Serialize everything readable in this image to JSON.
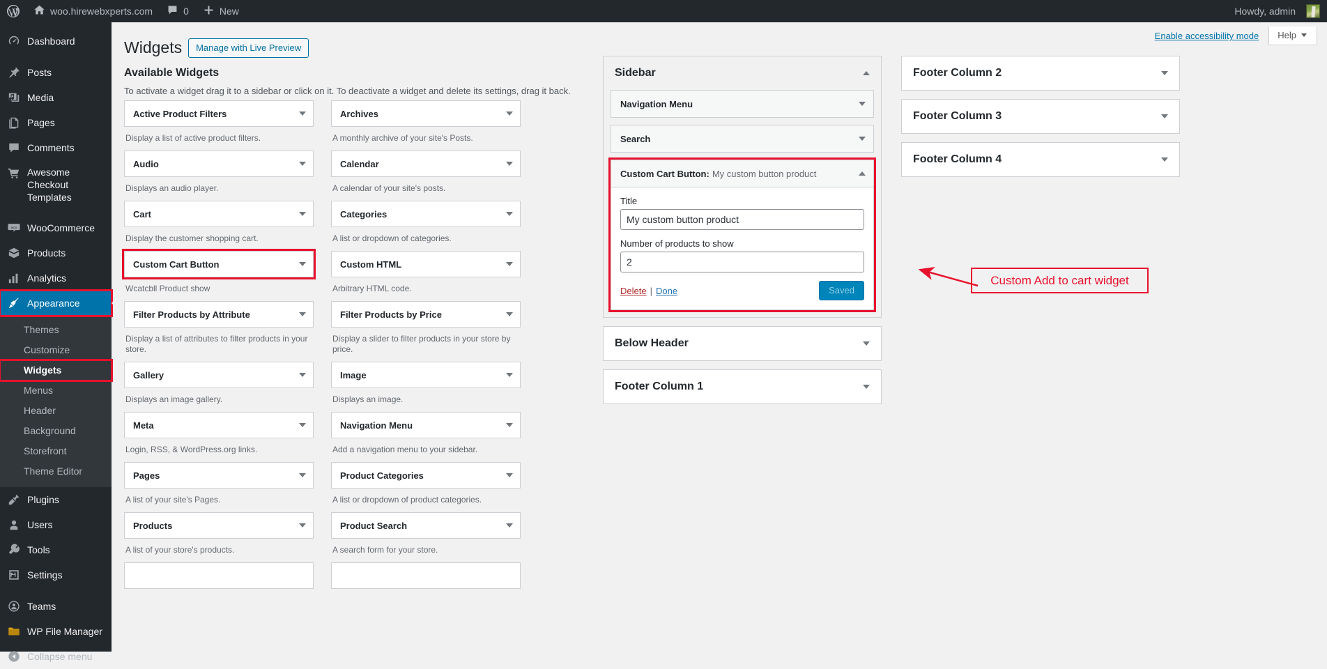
{
  "adminbar": {
    "logo_icon": "wordpress-logo-icon",
    "site_icon": "home-icon",
    "site_name": "woo.hirewebxperts.com",
    "comments_icon": "comment-bubble-icon",
    "comments_count": "0",
    "new_icon": "plus-icon",
    "new_label": "New",
    "howdy": "Howdy, admin",
    "avatar": "user-avatar"
  },
  "adminmenu": {
    "items": [
      {
        "label": "Dashboard",
        "icon": "dashboard-icon",
        "current": false
      },
      {
        "label": "Posts",
        "icon": "pin-icon",
        "current": false
      },
      {
        "label": "Media",
        "icon": "media-icon",
        "current": false
      },
      {
        "label": "Pages",
        "icon": "pages-icon",
        "current": false
      },
      {
        "label": "Comments",
        "icon": "comment-bubble-icon",
        "current": false
      },
      {
        "label": "Awesome Checkout Templates",
        "icon": "cart-icon",
        "current": false
      },
      {
        "label": "WooCommerce",
        "icon": "woo-icon",
        "current": false
      },
      {
        "label": "Products",
        "icon": "products-box-icon",
        "current": false
      },
      {
        "label": "Analytics",
        "icon": "bar-chart-icon",
        "current": false
      },
      {
        "label": "Appearance",
        "icon": "paintbrush-icon",
        "current": true
      },
      {
        "label": "Plugins",
        "icon": "plug-icon",
        "current": false
      },
      {
        "label": "Users",
        "icon": "user-icon",
        "current": false
      },
      {
        "label": "Tools",
        "icon": "wrench-icon",
        "current": false
      },
      {
        "label": "Settings",
        "icon": "settings-sliders-icon",
        "current": false
      },
      {
        "label": "Teams",
        "icon": "teams-icon",
        "current": false
      },
      {
        "label": "WP File Manager",
        "icon": "folder-icon",
        "current": false
      }
    ],
    "submenu": [
      {
        "label": "Themes",
        "current": false
      },
      {
        "label": "Customize",
        "current": false
      },
      {
        "label": "Widgets",
        "current": true
      },
      {
        "label": "Menus",
        "current": false
      },
      {
        "label": "Header",
        "current": false
      },
      {
        "label": "Background",
        "current": false
      },
      {
        "label": "Storefront",
        "current": false
      },
      {
        "label": "Theme Editor",
        "current": false
      }
    ],
    "collapse": {
      "label": "Collapse menu",
      "icon": "collapse-arrow-icon"
    }
  },
  "topbar": {
    "accessibility_link": "Enable accessibility mode",
    "help_label": "Help",
    "help_caret_icon": "chevron-down-icon"
  },
  "page": {
    "title": "Widgets",
    "live_preview_button": "Manage with Live Preview",
    "available_title": "Available Widgets",
    "available_desc": "To activate a widget drag it to a sidebar or click on it. To deactivate a widget and delete its settings, drag it back."
  },
  "available_widgets": [
    {
      "name": "Active Product Filters",
      "desc": "Display a list of active product filters.",
      "flagged": false
    },
    {
      "name": "Archives",
      "desc": "A monthly archive of your site's Posts.",
      "flagged": false
    },
    {
      "name": "Audio",
      "desc": "Displays an audio player.",
      "flagged": false
    },
    {
      "name": "Calendar",
      "desc": "A calendar of your site's posts.",
      "flagged": false
    },
    {
      "name": "Cart",
      "desc": "Display the customer shopping cart.",
      "flagged": false
    },
    {
      "name": "Categories",
      "desc": "A list or dropdown of categories.",
      "flagged": false
    },
    {
      "name": "Custom Cart Button",
      "desc": "Wcatcbll Product show",
      "flagged": true
    },
    {
      "name": "Custom HTML",
      "desc": "Arbitrary HTML code.",
      "flagged": false
    },
    {
      "name": "Filter Products by Attribute",
      "desc": "Display a list of attributes to filter products in your store.",
      "flagged": false
    },
    {
      "name": "Filter Products by Price",
      "desc": "Display a slider to filter products in your store by price.",
      "flagged": false
    },
    {
      "name": "Gallery",
      "desc": "Displays an image gallery.",
      "flagged": false
    },
    {
      "name": "Image",
      "desc": "Displays an image.",
      "flagged": false
    },
    {
      "name": "Meta",
      "desc": "Login, RSS, & WordPress.org links.",
      "flagged": false
    },
    {
      "name": "Navigation Menu",
      "desc": "Add a navigation menu to your sidebar.",
      "flagged": false
    },
    {
      "name": "Pages",
      "desc": "A list of your site's Pages.",
      "flagged": false
    },
    {
      "name": "Product Categories",
      "desc": "A list or dropdown of product categories.",
      "flagged": false
    },
    {
      "name": "Products",
      "desc": "A list of your store's products.",
      "flagged": false
    },
    {
      "name": "Product Search",
      "desc": "A search form for your store.",
      "flagged": false
    }
  ],
  "sidebar_panel": {
    "title": "Sidebar",
    "caret_icon": "chevron-up-icon",
    "widgets": [
      {
        "title": "Navigation Menu",
        "caret_icon": "chevron-down-icon",
        "open": false
      },
      {
        "title": "Search",
        "caret_icon": "chevron-down-icon",
        "open": false
      }
    ],
    "active_widget": {
      "title": "Custom Cart Button:",
      "subtitle": "My custom button product",
      "caret_icon": "chevron-up-icon",
      "title_field_label": "Title",
      "title_field_value": "My custom button product",
      "count_field_label": "Number of products to show",
      "count_field_value": "2",
      "delete_label": "Delete",
      "separator": "|",
      "done_label": "Done",
      "save_label": "Saved"
    }
  },
  "other_sidebars_col1": [
    {
      "title": "Below Header",
      "caret_icon": "chevron-down-icon"
    },
    {
      "title": "Footer Column 1",
      "caret_icon": "chevron-down-icon"
    }
  ],
  "other_sidebars_col2": [
    {
      "title": "Footer Column 2",
      "caret_icon": "chevron-down-icon"
    },
    {
      "title": "Footer Column 3",
      "caret_icon": "chevron-down-icon"
    },
    {
      "title": "Footer Column 4",
      "caret_icon": "chevron-down-icon"
    }
  ],
  "annotation": {
    "text": "Custom Add to cart widget",
    "color": "#e8112d",
    "arrow_icon": "arrow-left-icon"
  },
  "colors": {
    "admin_dark": "#23282d",
    "submenu_dark": "#32373c",
    "accent_blue": "#0073aa",
    "button_blue": "#0085ba",
    "highlight_red": "#e8112d",
    "page_bg": "#f1f1f1"
  }
}
